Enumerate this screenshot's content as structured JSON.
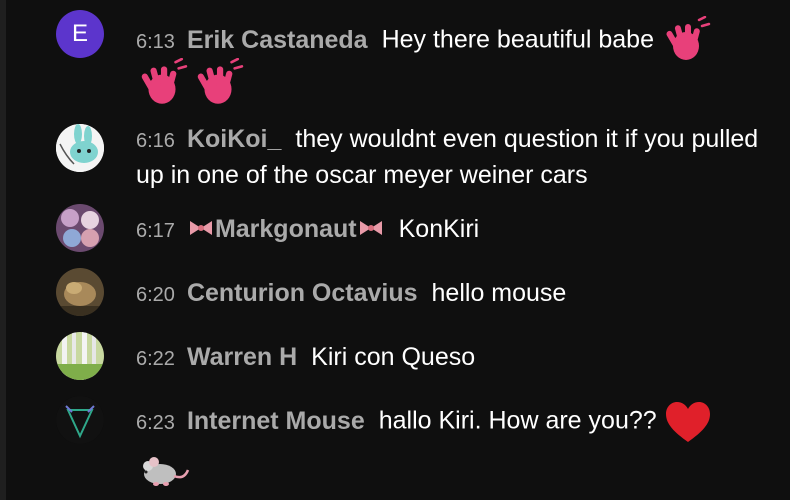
{
  "messages": [
    {
      "time": "6:13",
      "author": "Erik Castaneda",
      "text": "Hey there beautiful babe",
      "avatar_letter": "E",
      "avatar_color": "#5c35cc",
      "emoji": [
        "waving-hand",
        "waving-hand",
        "waving-hand"
      ]
    },
    {
      "time": "6:16",
      "author": "KoiKoi_",
      "text": "they wouldnt even question it if you pulled up in one of the oscar meyer weiner cars"
    },
    {
      "time": "6:17",
      "author": "Markgonaut",
      "text": "KonKiri",
      "decorations": [
        "ribbon",
        "ribbon"
      ]
    },
    {
      "time": "6:20",
      "author": "Centurion Octavius",
      "text": "hello mouse"
    },
    {
      "time": "6:22",
      "author": "Warren H",
      "text": "Kiri con Queso"
    },
    {
      "time": "6:23",
      "author": "Internet Mouse",
      "text": "hallo Kiri. How are you??",
      "emoji": [
        "red-heart",
        "mouse"
      ]
    }
  ],
  "colors": {
    "background": "#0f0f0f",
    "author": "#aaaaaa",
    "timestamp": "#aaaaaa",
    "message": "#ffffff",
    "wave": "#e8407a",
    "heart": "#e0202a"
  }
}
